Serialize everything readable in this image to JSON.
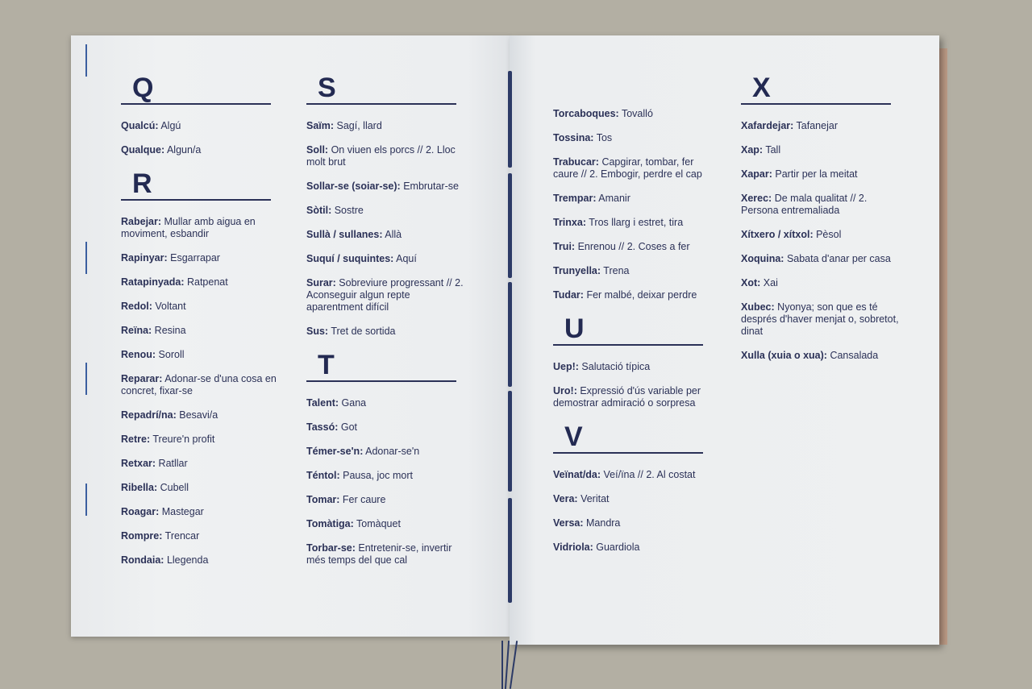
{
  "columns": [
    {
      "blocks": [
        {
          "letter": "Q",
          "entries": [
            {
              "term": "Qualcú:",
              "def": " Algú"
            },
            {
              "term": "Qualque:",
              "def": " Algun/a"
            }
          ]
        },
        {
          "letter": "R",
          "entries": [
            {
              "term": "Rabejar:",
              "def": " Mullar amb aigua en moviment, esbandir"
            },
            {
              "term": "Rapinyar:",
              "def": " Esgarrapar"
            },
            {
              "term": "Ratapinyada:",
              "def": " Ratpenat"
            },
            {
              "term": "Redol:",
              "def": " Voltant"
            },
            {
              "term": "Reïna:",
              "def": " Resina"
            },
            {
              "term": "Renou:",
              "def": " Soroll"
            },
            {
              "term": "Reparar:",
              "def": " Adonar-se d'una cosa en concret, fixar-se"
            },
            {
              "term": "Repadrí/na:",
              "def": " Besavi/a"
            },
            {
              "term": "Retre:",
              "def": " Treure'n profit"
            },
            {
              "term": "Retxar:",
              "def": " Ratllar"
            },
            {
              "term": "Ribella:",
              "def": " Cubell"
            },
            {
              "term": "Roagar:",
              "def": " Mastegar"
            },
            {
              "term": "Rompre:",
              "def": " Trencar"
            },
            {
              "term": "Rondaia:",
              "def": " Llegenda"
            }
          ]
        }
      ]
    },
    {
      "blocks": [
        {
          "letter": "S",
          "entries": [
            {
              "term": "Saïm:",
              "def": " Sagí, llard"
            },
            {
              "term": "Soll:",
              "def": " On viuen els porcs // 2. Lloc molt brut"
            },
            {
              "term": "Sollar-se (soiar-se):",
              "def": " Embrutar-se"
            },
            {
              "term": "Sòtil:",
              "def": " Sostre"
            },
            {
              "term": "Sullà / sullanes:",
              "def": " Allà"
            },
            {
              "term": "Suquí / suquintes:",
              "def": " Aquí"
            },
            {
              "term": "Surar:",
              "def": " Sobreviure progressant // 2. Aconseguir algun repte aparentment difícil"
            },
            {
              "term": "Sus:",
              "def": " Tret de sortida"
            }
          ]
        },
        {
          "letter": "T",
          "entries": [
            {
              "term": "Talent:",
              "def": " Gana"
            },
            {
              "term": "Tassó:",
              "def": " Got"
            },
            {
              "term": "Témer-se'n:",
              "def": " Adonar-se'n"
            },
            {
              "term": "Téntol:",
              "def": " Pausa, joc mort"
            },
            {
              "term": "Tomar:",
              "def": " Fer caure"
            },
            {
              "term": "Tomàtiga:",
              "def": " Tomàquet"
            },
            {
              "term": "Torbar-se:",
              "def": " Entretenir-se, invertir més temps del que cal"
            }
          ]
        }
      ]
    },
    {
      "blocks": [
        {
          "letter": "",
          "entries": [
            {
              "term": "Torcaboques:",
              "def": " Tovalló"
            },
            {
              "term": "Tossina:",
              "def": " Tos"
            },
            {
              "term": "Trabucar:",
              "def": " Capgirar, tombar, fer caure // 2. Embogir, perdre el cap"
            },
            {
              "term": "Trempar:",
              "def": " Amanir"
            },
            {
              "term": "Trinxa:",
              "def": " Tros llarg i estret, tira"
            },
            {
              "term": "Trui:",
              "def": " Enrenou // 2. Coses a fer"
            },
            {
              "term": "Trunyella:",
              "def": " Trena"
            },
            {
              "term": "Tudar:",
              "def": " Fer malbé, deixar perdre"
            }
          ]
        },
        {
          "letter": "U",
          "entries": [
            {
              "term": "Uep!:",
              "def": " Salutació típica"
            },
            {
              "term": "Uro!:",
              "def": " Expressió d'ús variable per demostrar admiració o sorpresa"
            }
          ]
        },
        {
          "letter": "V",
          "entries": [
            {
              "term": "Veïnat/da:",
              "def": " Veí/ïna // 2. Al costat"
            },
            {
              "term": "Vera:",
              "def": " Veritat"
            },
            {
              "term": "Versa:",
              "def": " Mandra"
            },
            {
              "term": "Vidriola:",
              "def": " Guardiola"
            }
          ]
        }
      ]
    },
    {
      "blocks": [
        {
          "letter": "X",
          "entries": [
            {
              "term": "Xafardejar:",
              "def": " Tafanejar"
            },
            {
              "term": "Xap:",
              "def": " Tall"
            },
            {
              "term": "Xapar:",
              "def": " Partir per la meitat"
            },
            {
              "term": "Xerec:",
              "def": " De mala qualitat // 2. Persona entremaliada"
            },
            {
              "term": "Xítxero / xítxol:",
              "def": " Pèsol"
            },
            {
              "term": "Xoquina:",
              "def": " Sabata d'anar per casa"
            },
            {
              "term": "Xot:",
              "def": " Xai"
            },
            {
              "term": "Xubec:",
              "def": " Nyonya; son que es té després d'haver menjat o, sobretot, dinat"
            },
            {
              "term": "Xulla (xuia o xua):",
              "def": " Cansalada"
            }
          ]
        }
      ]
    }
  ],
  "colors": {
    "ink": "#2b3157",
    "paper": "#eceef0",
    "background": "#b3afa3"
  }
}
